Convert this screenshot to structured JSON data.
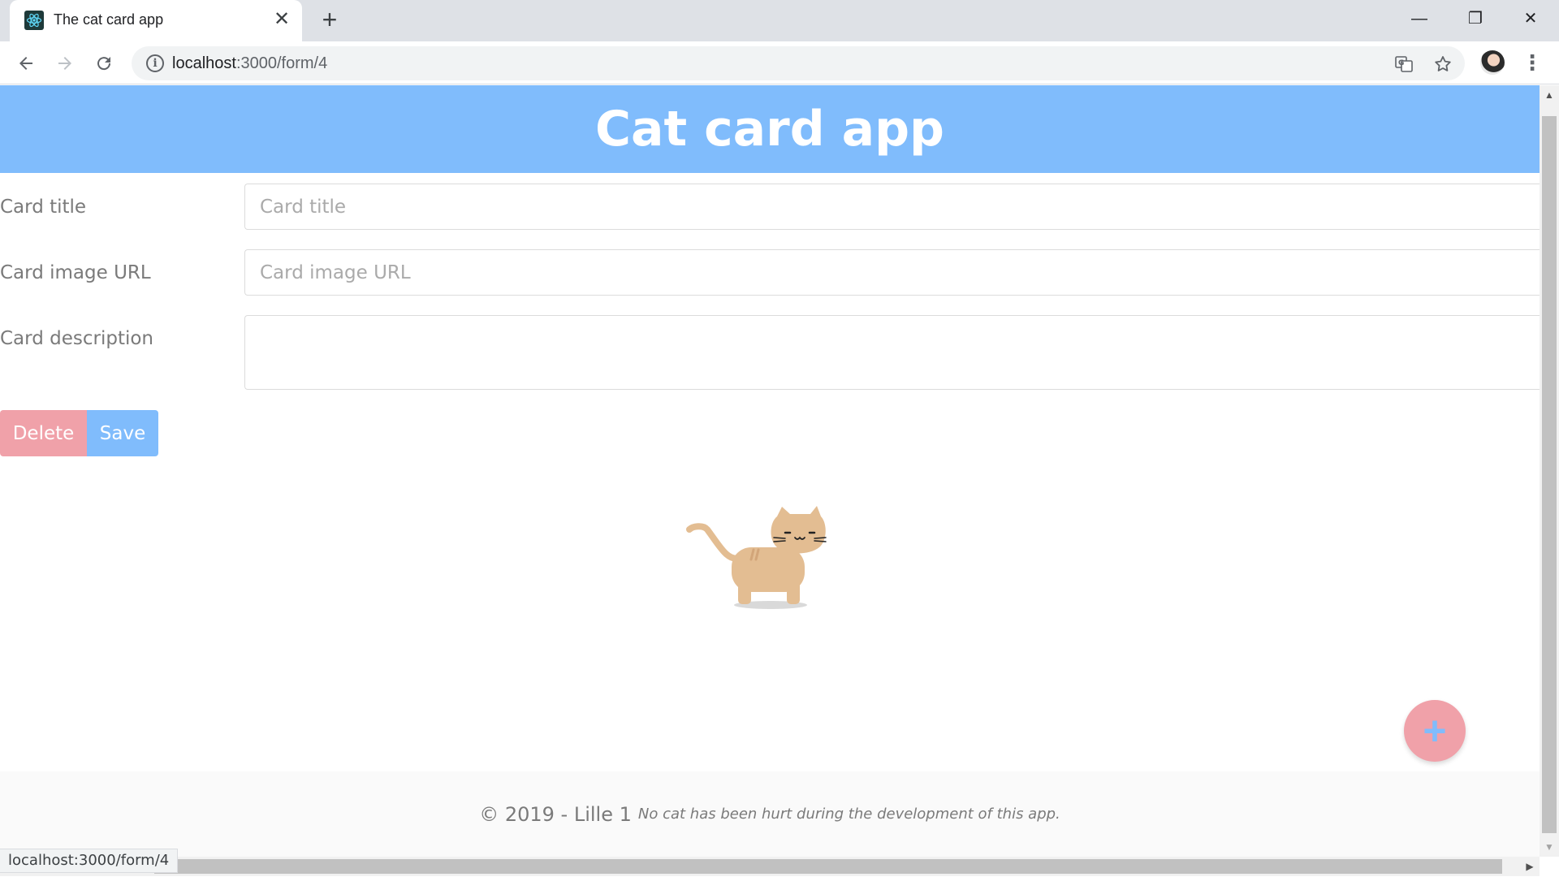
{
  "browser": {
    "tab_title": "The cat card app",
    "tab_close": "✕",
    "new_tab": "+",
    "url_host": "localhost",
    "url_path": ":3000/form/4",
    "status_url": "localhost:3000/form/4",
    "window_controls": {
      "minimize": "—",
      "restore": "❐",
      "close": "✕"
    }
  },
  "app": {
    "title": "Cat card app",
    "form": {
      "title_label": "Card title",
      "title_placeholder": "Card title",
      "image_label": "Card image URL",
      "image_placeholder": "Card image URL",
      "description_label": "Card description"
    },
    "buttons": {
      "delete": "Delete",
      "save": "Save"
    },
    "fab": "+",
    "footer": {
      "copyright": "© 2019 - Lille 1",
      "note": "No cat has been hurt during the development of this app."
    }
  },
  "colors": {
    "header_blue": "#80bcfc",
    "delete_pink": "#f0a1a9",
    "cat_body": "#e3bd92"
  },
  "icons": [
    "react-favicon-icon",
    "back-arrow-icon",
    "forward-arrow-icon",
    "reload-icon",
    "info-icon",
    "translate-icon",
    "star-icon",
    "profile-avatar",
    "more-vert-icon",
    "cat-illustration",
    "plus-icon"
  ]
}
